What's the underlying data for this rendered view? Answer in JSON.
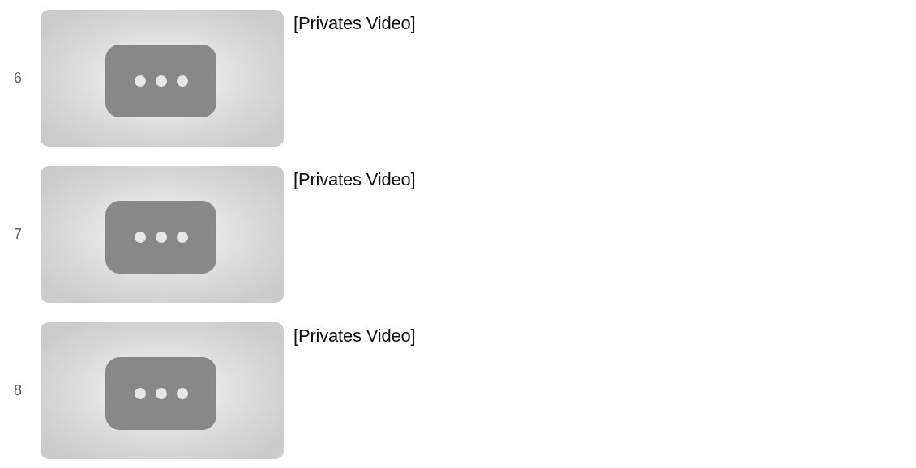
{
  "videos": [
    {
      "index": "6",
      "title": "[Privates Video]"
    },
    {
      "index": "7",
      "title": "[Privates Video]"
    },
    {
      "index": "8",
      "title": "[Privates Video]"
    }
  ]
}
